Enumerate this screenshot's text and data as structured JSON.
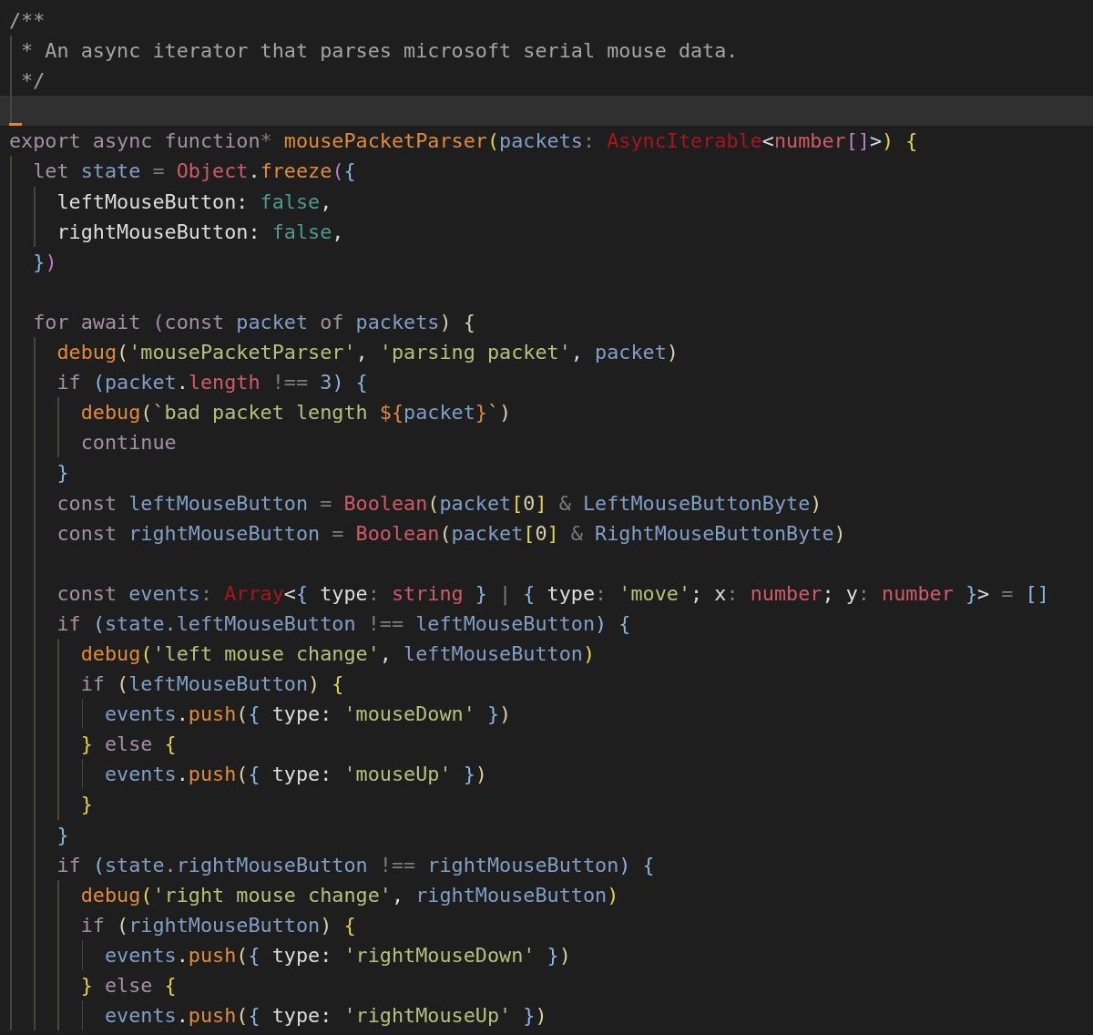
{
  "editor": {
    "lines": [
      {
        "tokens": [
          {
            "kind": "comment",
            "text": "/**"
          }
        ]
      },
      {
        "tokens": [
          {
            "kind": "comment",
            "text": " * An async iterator that parses microsoft serial mouse data."
          }
        ]
      },
      {
        "tokens": [
          {
            "kind": "comment",
            "text": " */"
          }
        ]
      },
      {
        "kind": "blank",
        "current": true
      },
      {
        "tokens": [
          {
            "kind": "keyword",
            "text": "export async function"
          },
          {
            "kind": "operator",
            "text": "*"
          },
          {
            "kind": "function",
            "text": " mousePacketParser"
          },
          {
            "kind": "bracket1",
            "text": "("
          },
          {
            "kind": "variable",
            "text": "packets"
          },
          {
            "kind": "operator",
            "text": ": "
          },
          {
            "kind": "error",
            "text": "AsyncIterable"
          },
          {
            "kind": "plain",
            "text": "<"
          },
          {
            "kind": "type",
            "text": "number"
          },
          {
            "kind": "bracket2",
            "text": "[]"
          },
          {
            "kind": "plain",
            "text": ">"
          },
          {
            "kind": "bracket1",
            "text": ")"
          },
          {
            "kind": "bracket1",
            "text": " {"
          }
        ]
      },
      {
        "tokens": [
          {
            "kind": "keyword",
            "text": "  let"
          },
          {
            "kind": "variable",
            "text": " state"
          },
          {
            "kind": "operator",
            "text": " = "
          },
          {
            "kind": "type",
            "text": "Object"
          },
          {
            "kind": "plain",
            "text": "."
          },
          {
            "kind": "function",
            "text": "freeze"
          },
          {
            "kind": "bracket2",
            "text": "("
          },
          {
            "kind": "bracket3",
            "text": "{"
          }
        ]
      },
      {
        "tokens": [
          {
            "kind": "plain",
            "text": "    leftMouseButton: "
          },
          {
            "kind": "boolean",
            "text": "false"
          },
          {
            "kind": "plain",
            "text": ","
          }
        ]
      },
      {
        "tokens": [
          {
            "kind": "plain",
            "text": "    rightMouseButton: "
          },
          {
            "kind": "boolean",
            "text": "false"
          },
          {
            "kind": "plain",
            "text": ","
          }
        ]
      },
      {
        "tokens": [
          {
            "kind": "bracket3",
            "text": "  }"
          },
          {
            "kind": "bracket2",
            "text": ")"
          }
        ]
      },
      {
        "kind": "blank"
      },
      {
        "tokens": [
          {
            "kind": "keyword",
            "text": "  for await (const"
          },
          {
            "kind": "variable",
            "text": " packet"
          },
          {
            "kind": "keyword",
            "text": " of"
          },
          {
            "kind": "variable",
            "text": " packets"
          },
          {
            "kind": "paren",
            "text": ") {"
          }
        ]
      },
      {
        "tokens": [
          {
            "kind": "function",
            "text": "    debug"
          },
          {
            "kind": "paren",
            "text": "("
          },
          {
            "kind": "string",
            "text": "'mousePacketParser'"
          },
          {
            "kind": "plain",
            "text": ", "
          },
          {
            "kind": "string",
            "text": "'parsing packet'"
          },
          {
            "kind": "plain",
            "text": ", "
          },
          {
            "kind": "variable",
            "text": "packet"
          },
          {
            "kind": "paren",
            "text": ")"
          }
        ]
      },
      {
        "tokens": [
          {
            "kind": "keyword",
            "text": "    if "
          },
          {
            "kind": "bracket3",
            "text": "("
          },
          {
            "kind": "variable",
            "text": "packet"
          },
          {
            "kind": "plain",
            "text": "."
          },
          {
            "kind": "type",
            "text": "length"
          },
          {
            "kind": "operator",
            "text": " !== "
          },
          {
            "kind": "number",
            "text": "3"
          },
          {
            "kind": "bracket3",
            "text": ")"
          },
          {
            "kind": "bracket3",
            "text": " {"
          }
        ]
      },
      {
        "tokens": [
          {
            "kind": "function",
            "text": "      debug"
          },
          {
            "kind": "paren",
            "text": "("
          },
          {
            "kind": "string",
            "text": "`bad packet length "
          },
          {
            "kind": "function",
            "text": "${"
          },
          {
            "kind": "variable",
            "text": "packet"
          },
          {
            "kind": "function",
            "text": "}"
          },
          {
            "kind": "string",
            "text": "`"
          },
          {
            "kind": "paren",
            "text": ")"
          }
        ]
      },
      {
        "tokens": [
          {
            "kind": "keyword",
            "text": "      continue"
          }
        ]
      },
      {
        "tokens": [
          {
            "kind": "bracket3",
            "text": "    }"
          }
        ]
      },
      {
        "tokens": [
          {
            "kind": "keyword",
            "text": "    const"
          },
          {
            "kind": "variable",
            "text": " leftMouseButton"
          },
          {
            "kind": "operator",
            "text": " = "
          },
          {
            "kind": "type",
            "text": "Boolean"
          },
          {
            "kind": "paren",
            "text": "("
          },
          {
            "kind": "variable",
            "text": "packet"
          },
          {
            "kind": "bracket1",
            "text": "["
          },
          {
            "kind": "paren",
            "text": "0"
          },
          {
            "kind": "bracket1",
            "text": "]"
          },
          {
            "kind": "operator",
            "text": " & "
          },
          {
            "kind": "variable",
            "text": "LeftMouseButtonByte"
          },
          {
            "kind": "paren",
            "text": ")"
          }
        ]
      },
      {
        "tokens": [
          {
            "kind": "keyword",
            "text": "    const"
          },
          {
            "kind": "variable",
            "text": " rightMouseButton"
          },
          {
            "kind": "operator",
            "text": " = "
          },
          {
            "kind": "type",
            "text": "Boolean"
          },
          {
            "kind": "paren",
            "text": "("
          },
          {
            "kind": "variable",
            "text": "packet"
          },
          {
            "kind": "bracket1",
            "text": "["
          },
          {
            "kind": "paren",
            "text": "0"
          },
          {
            "kind": "bracket1",
            "text": "]"
          },
          {
            "kind": "operator",
            "text": " & "
          },
          {
            "kind": "variable",
            "text": "RightMouseButtonByte"
          },
          {
            "kind": "paren",
            "text": ")"
          }
        ]
      },
      {
        "kind": "blank"
      },
      {
        "tokens": [
          {
            "kind": "keyword",
            "text": "    const"
          },
          {
            "kind": "variable",
            "text": " events"
          },
          {
            "kind": "operator",
            "text": ": "
          },
          {
            "kind": "error",
            "text": "Array"
          },
          {
            "kind": "plain",
            "text": "<"
          },
          {
            "kind": "bracket3",
            "text": "{"
          },
          {
            "kind": "plain",
            "text": " type"
          },
          {
            "kind": "operator",
            "text": ": "
          },
          {
            "kind": "type",
            "text": "string"
          },
          {
            "kind": "bracket3",
            "text": " }"
          },
          {
            "kind": "operator",
            "text": " | "
          },
          {
            "kind": "bracket3",
            "text": "{"
          },
          {
            "kind": "plain",
            "text": " type"
          },
          {
            "kind": "operator",
            "text": ": "
          },
          {
            "kind": "string",
            "text": "'move'"
          },
          {
            "kind": "plain",
            "text": "; x"
          },
          {
            "kind": "operator",
            "text": ": "
          },
          {
            "kind": "type",
            "text": "number"
          },
          {
            "kind": "plain",
            "text": "; y"
          },
          {
            "kind": "operator",
            "text": ": "
          },
          {
            "kind": "type",
            "text": "number"
          },
          {
            "kind": "bracket3",
            "text": " }"
          },
          {
            "kind": "plain",
            "text": ">"
          },
          {
            "kind": "operator",
            "text": " = "
          },
          {
            "kind": "bracket3",
            "text": "[]"
          }
        ]
      },
      {
        "tokens": [
          {
            "kind": "keyword",
            "text": "    if "
          },
          {
            "kind": "bracket3",
            "text": "("
          },
          {
            "kind": "variable",
            "text": "state.leftMouseButton"
          },
          {
            "kind": "operator",
            "text": " !== "
          },
          {
            "kind": "variable",
            "text": "leftMouseButton"
          },
          {
            "kind": "bracket3",
            "text": ")"
          },
          {
            "kind": "bracket3",
            "text": " {"
          }
        ]
      },
      {
        "tokens": [
          {
            "kind": "function",
            "text": "      debug"
          },
          {
            "kind": "bracket1",
            "text": "("
          },
          {
            "kind": "string",
            "text": "'left mouse change'"
          },
          {
            "kind": "plain",
            "text": ", "
          },
          {
            "kind": "variable",
            "text": "leftMouseButton"
          },
          {
            "kind": "bracket1",
            "text": ")"
          }
        ]
      },
      {
        "tokens": [
          {
            "kind": "keyword",
            "text": "      if "
          },
          {
            "kind": "paren",
            "text": "("
          },
          {
            "kind": "variable",
            "text": "leftMouseButton"
          },
          {
            "kind": "paren",
            "text": ")"
          },
          {
            "kind": "bracket1",
            "text": " {"
          }
        ]
      },
      {
        "tokens": [
          {
            "kind": "variable",
            "text": "        events"
          },
          {
            "kind": "plain",
            "text": "."
          },
          {
            "kind": "function",
            "text": "push"
          },
          {
            "kind": "paren",
            "text": "("
          },
          {
            "kind": "bracket3",
            "text": "{"
          },
          {
            "kind": "plain",
            "text": " type: "
          },
          {
            "kind": "string",
            "text": "'mouseDown'"
          },
          {
            "kind": "bracket3",
            "text": " }"
          },
          {
            "kind": "paren",
            "text": ")"
          }
        ]
      },
      {
        "tokens": [
          {
            "kind": "bracket1",
            "text": "      }"
          },
          {
            "kind": "keyword",
            "text": " else"
          },
          {
            "kind": "bracket1",
            "text": " {"
          }
        ]
      },
      {
        "tokens": [
          {
            "kind": "variable",
            "text": "        events"
          },
          {
            "kind": "plain",
            "text": "."
          },
          {
            "kind": "function",
            "text": "push"
          },
          {
            "kind": "paren",
            "text": "("
          },
          {
            "kind": "bracket3",
            "text": "{"
          },
          {
            "kind": "plain",
            "text": " type: "
          },
          {
            "kind": "string",
            "text": "'mouseUp'"
          },
          {
            "kind": "bracket3",
            "text": " }"
          },
          {
            "kind": "paren",
            "text": ")"
          }
        ]
      },
      {
        "tokens": [
          {
            "kind": "bracket1",
            "text": "      }"
          }
        ]
      },
      {
        "tokens": [
          {
            "kind": "bracket3",
            "text": "    }"
          }
        ]
      },
      {
        "tokens": [
          {
            "kind": "keyword",
            "text": "    if "
          },
          {
            "kind": "bracket3",
            "text": "("
          },
          {
            "kind": "variable",
            "text": "state.rightMouseButton"
          },
          {
            "kind": "operator",
            "text": " !== "
          },
          {
            "kind": "variable",
            "text": "rightMouseButton"
          },
          {
            "kind": "bracket3",
            "text": ")"
          },
          {
            "kind": "bracket3",
            "text": " {"
          }
        ]
      },
      {
        "tokens": [
          {
            "kind": "function",
            "text": "      debug"
          },
          {
            "kind": "bracket1",
            "text": "("
          },
          {
            "kind": "string",
            "text": "'right mouse change'"
          },
          {
            "kind": "plain",
            "text": ", "
          },
          {
            "kind": "variable",
            "text": "rightMouseButton"
          },
          {
            "kind": "bracket1",
            "text": ")"
          }
        ]
      },
      {
        "tokens": [
          {
            "kind": "keyword",
            "text": "      if "
          },
          {
            "kind": "paren",
            "text": "("
          },
          {
            "kind": "variable",
            "text": "rightMouseButton"
          },
          {
            "kind": "paren",
            "text": ")"
          },
          {
            "kind": "bracket1",
            "text": " {"
          }
        ]
      },
      {
        "tokens": [
          {
            "kind": "variable",
            "text": "        events"
          },
          {
            "kind": "plain",
            "text": "."
          },
          {
            "kind": "function",
            "text": "push"
          },
          {
            "kind": "paren",
            "text": "("
          },
          {
            "kind": "bracket3",
            "text": "{"
          },
          {
            "kind": "plain",
            "text": " type: "
          },
          {
            "kind": "string",
            "text": "'rightMouseDown'"
          },
          {
            "kind": "bracket3",
            "text": " }"
          },
          {
            "kind": "paren",
            "text": ")"
          }
        ]
      },
      {
        "tokens": [
          {
            "kind": "bracket1",
            "text": "      }"
          },
          {
            "kind": "keyword",
            "text": " else"
          },
          {
            "kind": "bracket1",
            "text": " {"
          }
        ]
      },
      {
        "tokens": [
          {
            "kind": "variable",
            "text": "        events"
          },
          {
            "kind": "plain",
            "text": "."
          },
          {
            "kind": "function",
            "text": "push"
          },
          {
            "kind": "paren",
            "text": "("
          },
          {
            "kind": "bracket3",
            "text": "{"
          },
          {
            "kind": "plain",
            "text": " type: "
          },
          {
            "kind": "string",
            "text": "'rightMouseUp'"
          },
          {
            "kind": "bracket3",
            "text": " }"
          },
          {
            "kind": "paren",
            "text": ")"
          }
        ]
      }
    ]
  }
}
